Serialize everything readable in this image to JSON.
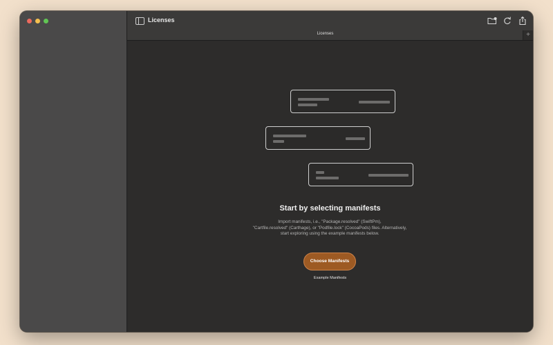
{
  "window": {
    "title": "Licenses"
  },
  "toolbar": {
    "icons": [
      "sidebar-toggle-icon",
      "folder-badge-icon",
      "refresh-icon",
      "share-icon"
    ]
  },
  "tabs": [
    {
      "label": "Licenses"
    }
  ],
  "empty_state": {
    "heading": "Start by selecting manifests",
    "description_lines": [
      "Import manifests, i.e., \"Package.resolved\" (SwiftPm),",
      "\"Cartfile.resolved\" (Carthage), or \"Podfile.lock\" (CocoaPods) files. Alternatively,",
      "start exploring using the example manifests below."
    ],
    "primary_button": "Choose Manifests",
    "secondary_button": "Example Manifests"
  },
  "colors": {
    "accent": "#9d5a23",
    "accent_border": "#cc8248",
    "background": "#2d2c2b",
    "sidebar": "#4a4949",
    "desktop": "#f2e0cb"
  }
}
